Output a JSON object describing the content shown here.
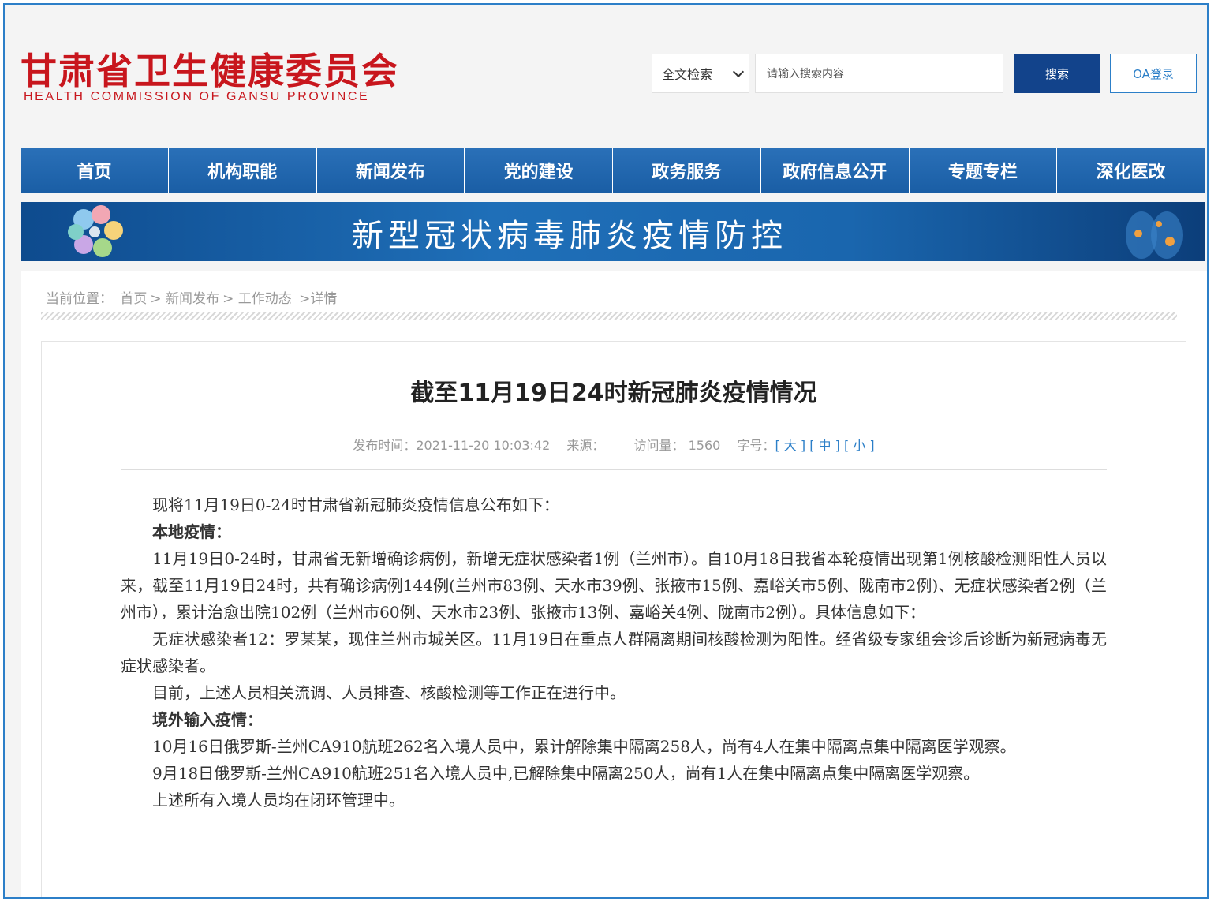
{
  "header": {
    "logo_cn": "甘肃省卫生健康委员会",
    "logo_en": "HEALTH COMMISSION OF GANSU PROVINCE",
    "search_scope": "全文检索",
    "search_placeholder": "请输入搜索内容",
    "search_button": "搜索",
    "oa_button": "OA登录"
  },
  "nav": {
    "items": [
      "首页",
      "机构职能",
      "新闻发布",
      "党的建设",
      "政务服务",
      "政府信息公开",
      "专题专栏",
      "深化医改"
    ]
  },
  "banner": {
    "title": "新型冠状病毒肺炎疫情防控"
  },
  "breadcrumb": {
    "label": "当前位置：",
    "home": "首页",
    "news": "新闻发布",
    "work": "工作动态",
    "detail": ">详情"
  },
  "article": {
    "title": "截至11月19日24时新冠肺炎疫情情况",
    "publish_label": "发布时间：",
    "publish_time": "2021-11-20 10:03:42",
    "source_label": "来源：",
    "visits_label": "访问量：",
    "visits": "1560",
    "font_label": "字号：",
    "font_large": "大",
    "font_medium": "中",
    "font_small": "小",
    "paragraphs": [
      "现将11月19日0-24时甘肃省新冠肺炎疫情信息公布如下：",
      "本地疫情：",
      "11月19日0-24时，甘肃省无新增确诊病例，新增无症状感染者1例（兰州市）。自10月18日我省本轮疫情出现第1例核酸检测阳性人员以来，截至11月19日24时，共有确诊病例144例(兰州市83例、天水市39例、张掖市15例、嘉峪关市5例、陇南市2例)、无症状感染者2例（兰州市），累计治愈出院102例（兰州市60例、天水市23例、张掖市13例、嘉峪关4例、陇南市2例）。具体信息如下：",
      "无症状感染者12：罗某某，现住兰州市城关区。11月19日在重点人群隔离期间核酸检测为阳性。经省级专家组会诊后诊断为新冠病毒无症状感染者。",
      "目前，上述人员相关流调、人员排查、核酸检测等工作正在进行中。",
      "境外输入疫情：",
      "10月16日俄罗斯-兰州CA910航班262名入境人员中，累计解除集中隔离258人，尚有4人在集中隔离点集中隔离医学观察。",
      "9月18日俄罗斯-兰州CA910航班251名入境人员中,已解除集中隔离250人，尚有1人在集中隔离点集中隔离医学观察。",
      "上述所有入境人员均在闭环管理中。"
    ]
  }
}
